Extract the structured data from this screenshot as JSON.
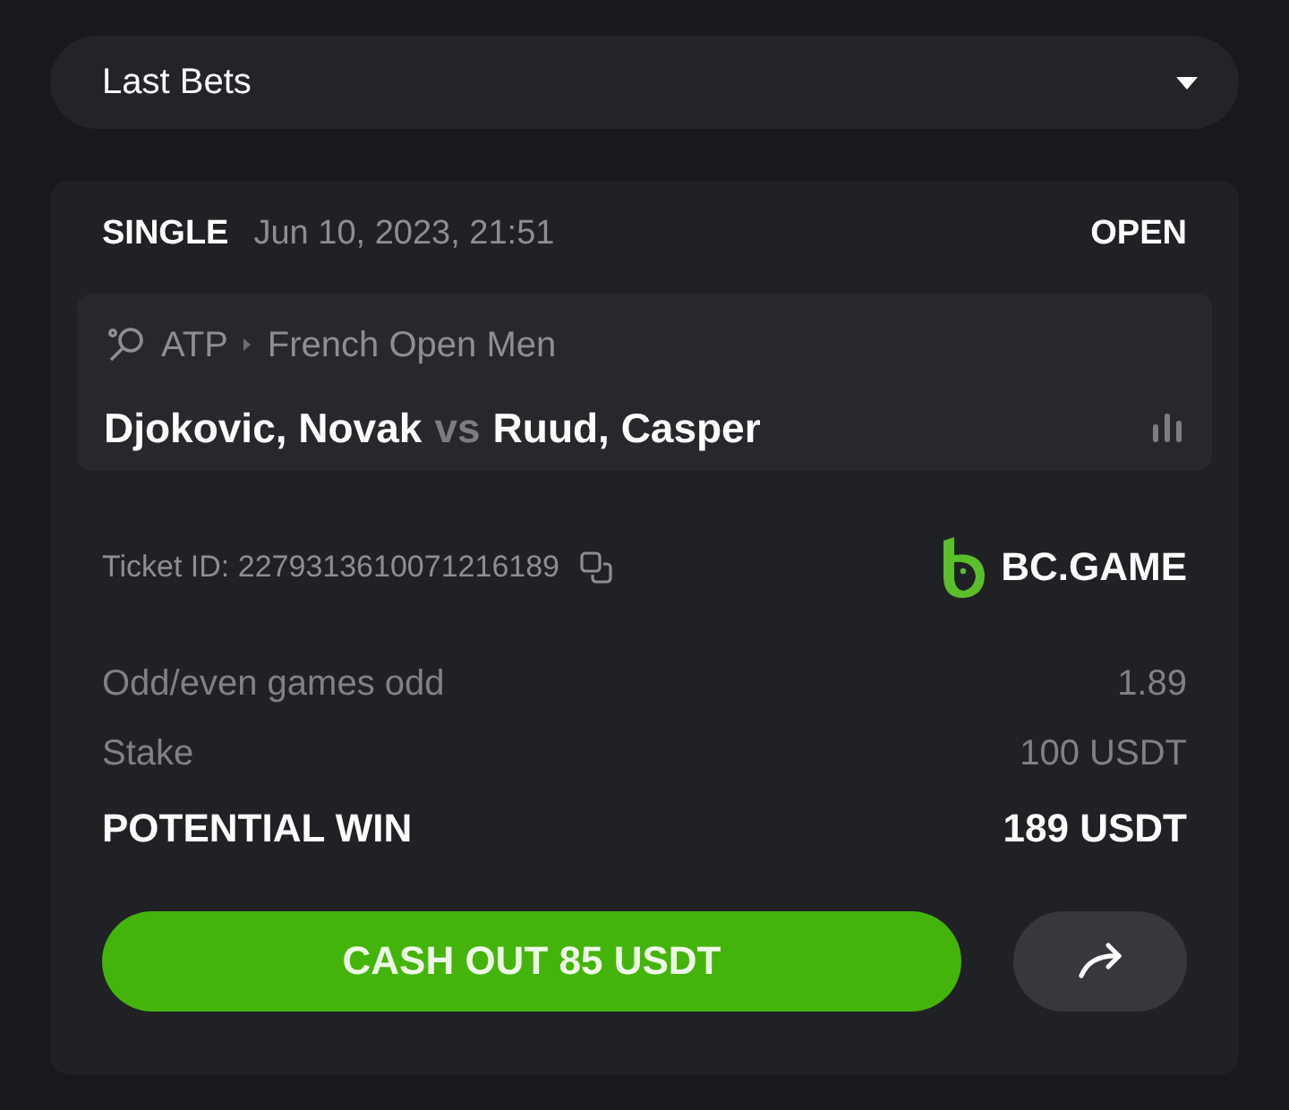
{
  "dropdown": {
    "label": "Last Bets",
    "expanded": false
  },
  "bet": {
    "type": "SINGLE",
    "date": "Jun 10, 2023, 21:51",
    "status": "OPEN",
    "match": {
      "league": "ATP",
      "tournament": "French Open Men",
      "home": "Djokovic, Novak",
      "vs": "vs",
      "away": "Ruud, Casper"
    },
    "ticket_id": "Ticket ID: 2279313610071216189",
    "brand": "BC.GAME",
    "details": [
      {
        "kind": "muted",
        "label": "Odd/even games odd",
        "value": "1.89"
      },
      {
        "kind": "muted",
        "label": "Stake",
        "value": "100 USDT"
      },
      {
        "kind": "total",
        "label": "POTENTIAL WIN",
        "value": "189 USDT"
      }
    ],
    "cashout_button": "CASH OUT 85 USDT"
  }
}
